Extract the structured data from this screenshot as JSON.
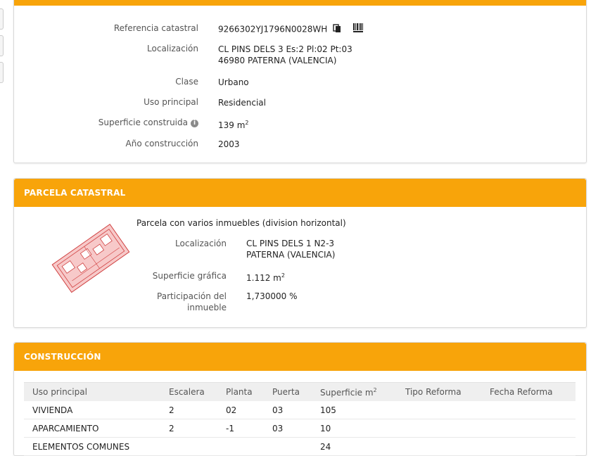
{
  "top_panel": {
    "rows": [
      {
        "label": "Referencia catastral",
        "value": "9266302YJ1796N0028WH"
      },
      {
        "label": "Localización",
        "value": "CL PINS DELS 3 Es:2 Pl:02 Pt:03",
        "value2": "46980 PATERNA (VALENCIA)"
      },
      {
        "label": "Clase",
        "value": "Urbano"
      },
      {
        "label": "Uso principal",
        "value": "Residencial"
      },
      {
        "label": "Superficie construida",
        "value": "139 m",
        "sup": "2"
      },
      {
        "label": "Año construcción",
        "value": "2003"
      }
    ]
  },
  "parcela": {
    "title": "PARCELA CATASTRAL",
    "description": "Parcela con varios inmuebles (division horizontal)",
    "loc_label": "Localización",
    "loc_line1": "CL PINS DELS 1 N2-3",
    "loc_line2": "PATERNA (VALENCIA)",
    "sup_label": "Superficie gráfica",
    "sup_value": "1.112 m",
    "sup_exp": "2",
    "part_label1": "Participación del",
    "part_label2": "inmueble",
    "part_value": "1,730000 %"
  },
  "construccion": {
    "title": "CONSTRUCCIÓN",
    "headers": [
      "Uso principal",
      "Escalera",
      "Planta",
      "Puerta",
      "Superficie m",
      "Tipo Reforma",
      "Fecha Reforma"
    ],
    "sup_header_exp": "2",
    "rows": [
      [
        "VIVIENDA",
        "2",
        "02",
        "03",
        "105",
        "",
        ""
      ],
      [
        "APARCAMIENTO",
        "2",
        "-1",
        "03",
        "10",
        "",
        ""
      ],
      [
        "ELEMENTOS COMUNES",
        "",
        "",
        "",
        "24",
        "",
        ""
      ]
    ]
  },
  "icons": {
    "copy": "copy-icon",
    "barcode": "barcode-icon",
    "info": "info-icon"
  },
  "colors": {
    "accent": "#f8a40a",
    "parcel_fill": "#f7c9c9",
    "parcel_stroke": "#d04040"
  }
}
